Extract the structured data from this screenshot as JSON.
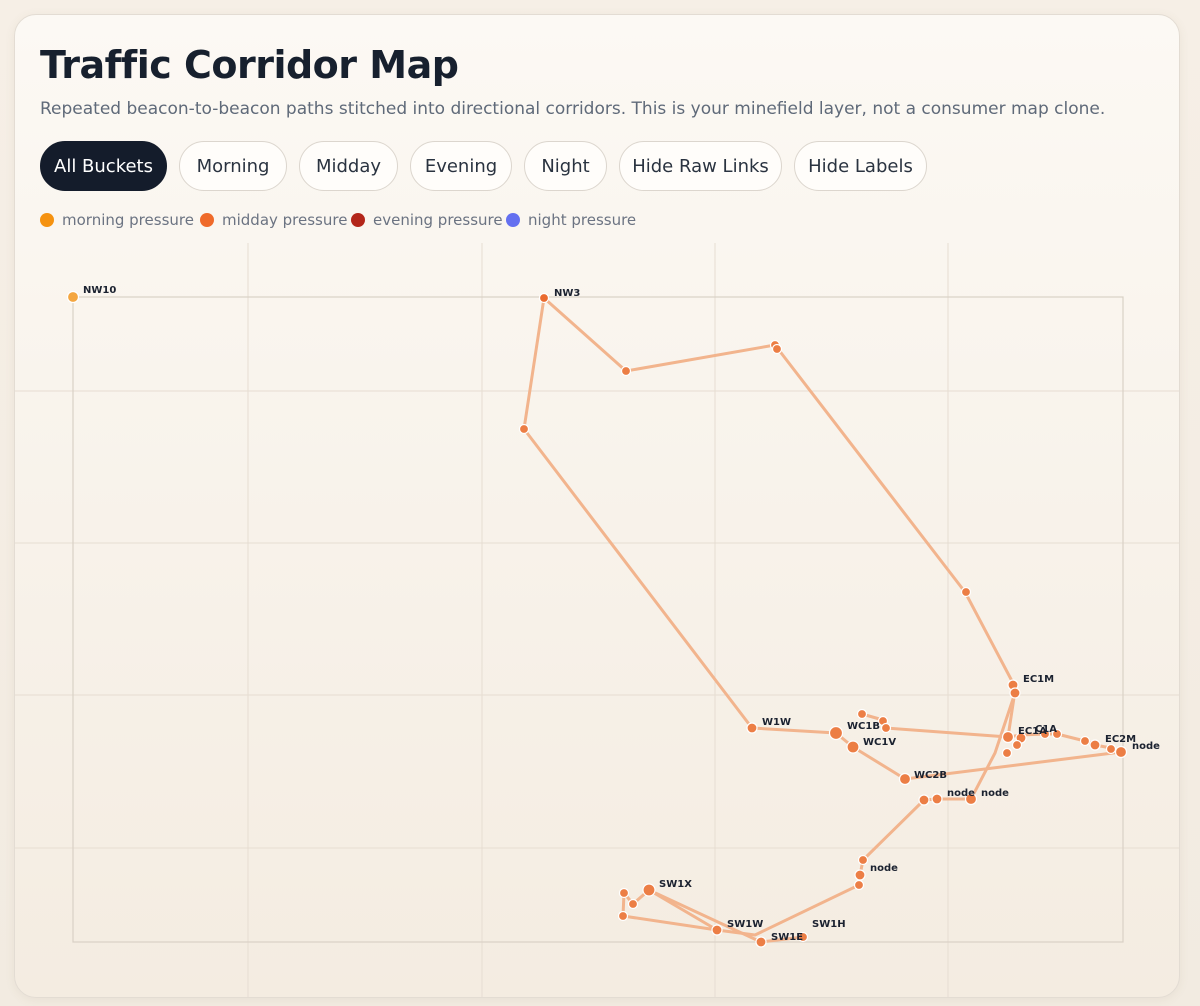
{
  "header": {
    "title": "Traffic Corridor Map",
    "subtitle": "Repeated beacon-to-beacon paths stitched into directional corridors. This is your minefield layer, not a consumer map clone."
  },
  "toolbar": {
    "buttons": [
      {
        "label": "All Buckets",
        "active": true
      },
      {
        "label": "Morning",
        "active": false
      },
      {
        "label": "Midday",
        "active": false
      },
      {
        "label": "Evening",
        "active": false
      },
      {
        "label": "Night",
        "active": false
      },
      {
        "label": "Hide Raw Links",
        "active": false
      },
      {
        "label": "Hide Labels",
        "active": false
      }
    ]
  },
  "legend": {
    "items": [
      {
        "label": "morning pressure",
        "color": "#f59210"
      },
      {
        "label": "midday pressure",
        "color": "#ef6a2a"
      },
      {
        "label": "evening pressure",
        "color": "#b3261a"
      },
      {
        "label": "night pressure",
        "color": "#6470f0"
      }
    ]
  },
  "map": {
    "link_color": "#f2b48d",
    "node_color": "#ec7e45",
    "labels": [
      "NW10",
      "NW3",
      "EC1M",
      "W1W",
      "WC1B",
      "WC1V",
      "EC1A",
      "C1A",
      "EC2M",
      "node",
      "WC2B",
      "node",
      "node",
      "node",
      "SW1X",
      "SW1W",
      "SW1E",
      "SW1H"
    ]
  }
}
